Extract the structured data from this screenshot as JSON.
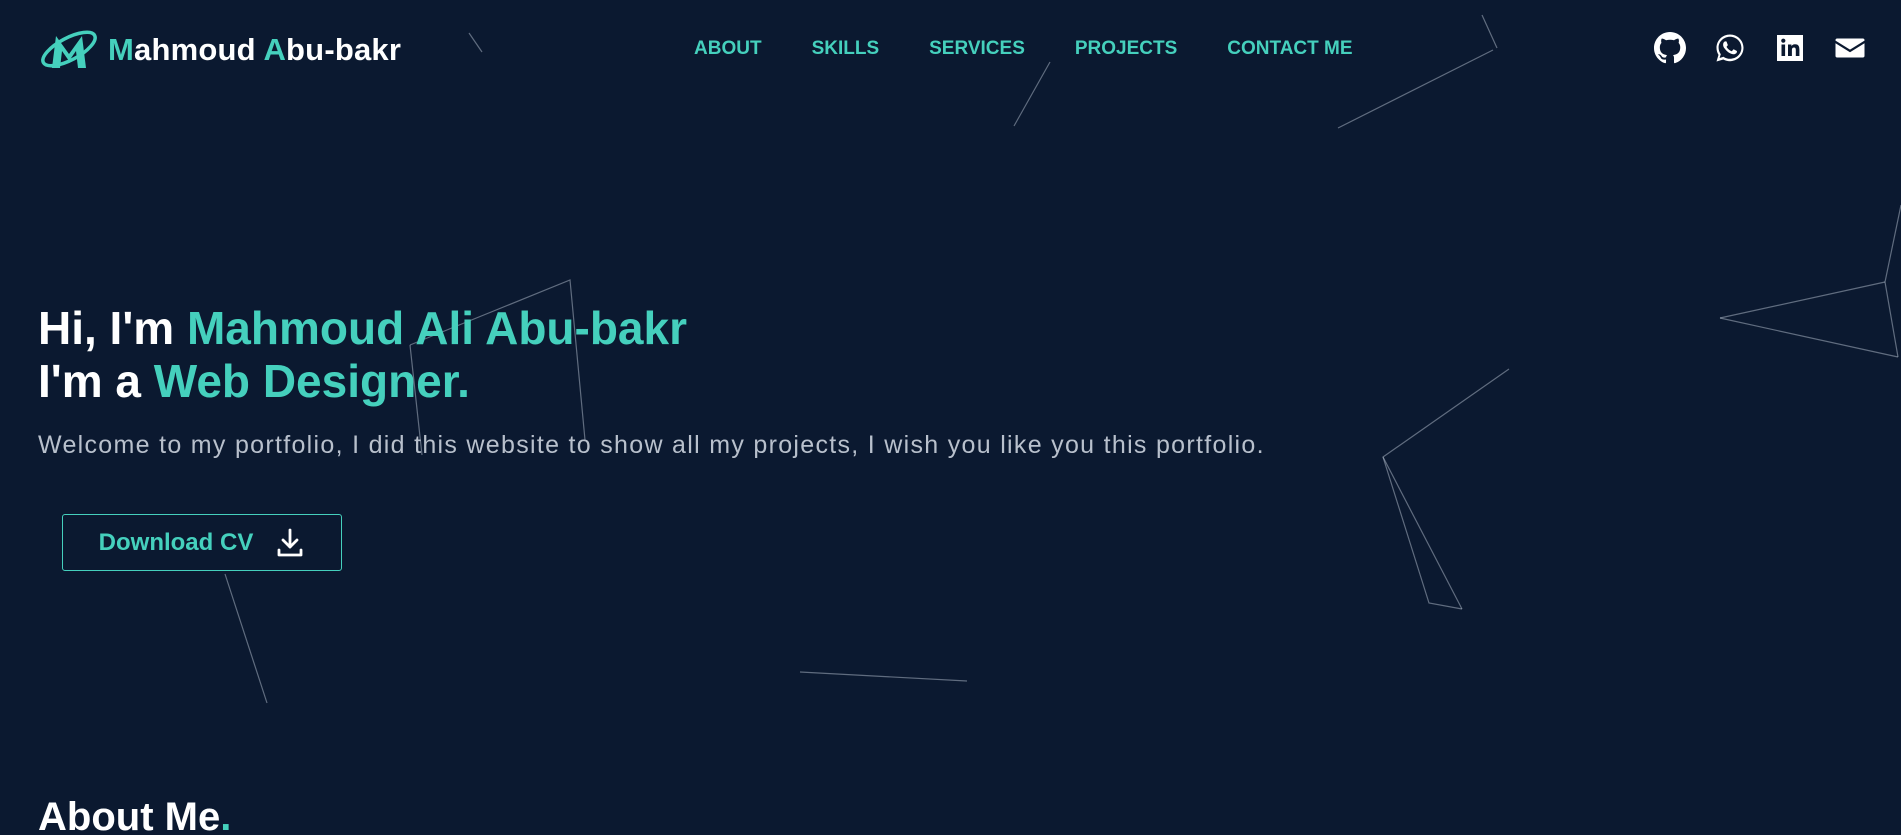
{
  "header": {
    "brand": {
      "first_initial": "M",
      "first_rest": "ahmoud ",
      "last_initial": "A",
      "last_rest": "bu-bakr"
    },
    "nav": [
      {
        "label": "ABOUT"
      },
      {
        "label": "SKILLS"
      },
      {
        "label": "SERVICES"
      },
      {
        "label": "PROJECTS"
      },
      {
        "label": "CONTACT ME"
      }
    ],
    "socials": [
      {
        "icon": "github-icon"
      },
      {
        "icon": "whatsapp-icon"
      },
      {
        "icon": "linkedin-icon"
      },
      {
        "icon": "mail-icon"
      }
    ]
  },
  "hero": {
    "greeting_prefix": "Hi, I'm ",
    "name": "Mahmoud Ali Abu-bakr",
    "role_prefix": "I'm a ",
    "role": "Web Designer.",
    "intro": "Welcome to my portfolio, I did this website to show all my projects, I wish you like you this portfolio.",
    "cv_button_label": "Download CV",
    "cv_button_icon": "download-icon"
  },
  "about": {
    "title": "About Me",
    "title_dot": "."
  },
  "colors": {
    "background": "#0b1930",
    "accent": "#45d0bd",
    "text": "#ffffff",
    "muted_text": "#b8c0cc"
  }
}
